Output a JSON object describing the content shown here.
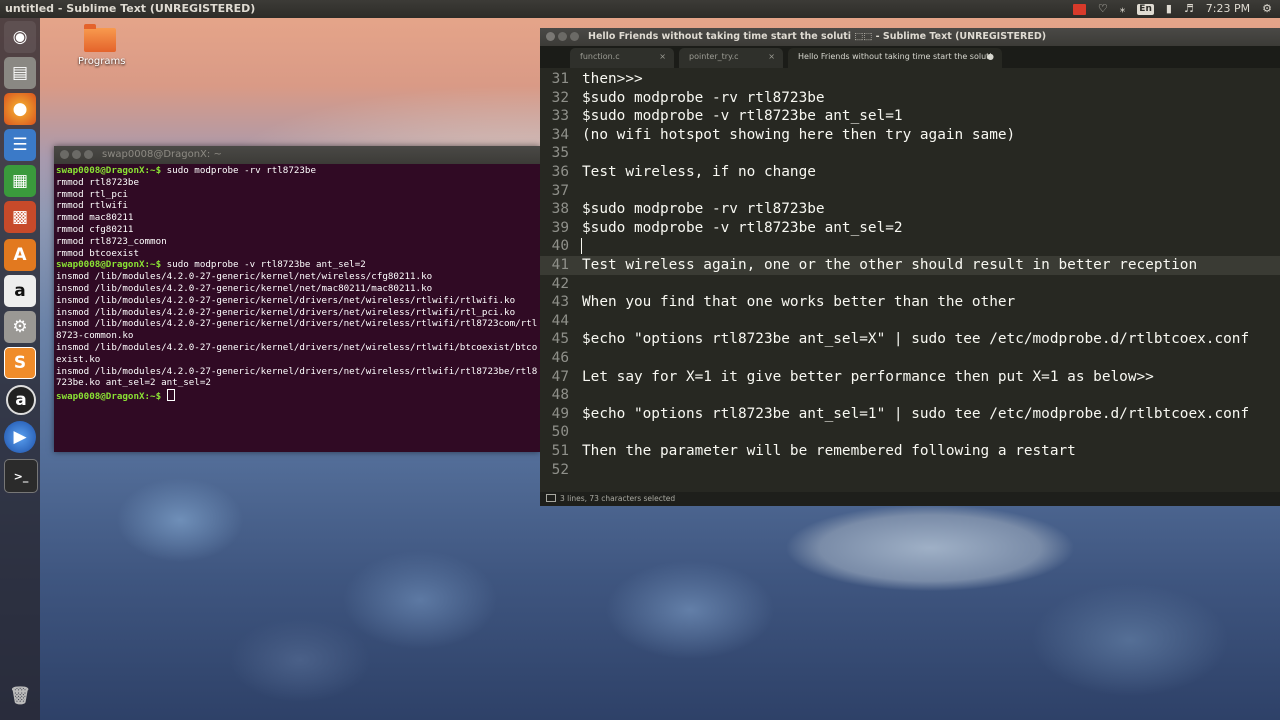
{
  "top_panel": {
    "window_title": "untitled - Sublime Text (UNREGISTERED)",
    "language": "En",
    "clock": "7:23 PM"
  },
  "desktop": {
    "icons": [
      {
        "label": "Programs",
        "icon": "folder-icon"
      }
    ]
  },
  "launcher": {
    "items": [
      "dash-icon",
      "files-icon",
      "firefox-icon",
      "writer-icon",
      "calc-icon",
      "impress-icon",
      "software-center-icon",
      "amazon-icon",
      "settings-icon",
      "sublime-text-icon",
      "amazon-alt-icon",
      "video-player-icon",
      "terminal-icon",
      "trash-icon"
    ]
  },
  "terminal": {
    "title": "swap0008@DragonX: ~",
    "lines": [
      {
        "prompt": "swap0008@DragonX:~$",
        "text": " sudo modprobe -rv rtl8723be"
      },
      {
        "prompt": "",
        "text": "rmmod rtl8723be"
      },
      {
        "prompt": "",
        "text": "rmmod rtl_pci"
      },
      {
        "prompt": "",
        "text": "rmmod rtlwifi"
      },
      {
        "prompt": "",
        "text": "rmmod mac80211"
      },
      {
        "prompt": "",
        "text": "rmmod cfg80211"
      },
      {
        "prompt": "",
        "text": "rmmod rtl8723_common"
      },
      {
        "prompt": "",
        "text": "rmmod btcoexist"
      },
      {
        "prompt": "swap0008@DragonX:~$",
        "text": " sudo modprobe -v rtl8723be ant_sel=2"
      },
      {
        "prompt": "",
        "text": "insmod /lib/modules/4.2.0-27-generic/kernel/net/wireless/cfg80211.ko"
      },
      {
        "prompt": "",
        "text": "insmod /lib/modules/4.2.0-27-generic/kernel/net/mac80211/mac80211.ko"
      },
      {
        "prompt": "",
        "text": "insmod /lib/modules/4.2.0-27-generic/kernel/drivers/net/wireless/rtlwifi/rtlwifi.ko"
      },
      {
        "prompt": "",
        "text": "insmod /lib/modules/4.2.0-27-generic/kernel/drivers/net/wireless/rtlwifi/rtl_pci.ko"
      },
      {
        "prompt": "",
        "text": "insmod /lib/modules/4.2.0-27-generic/kernel/drivers/net/wireless/rtlwifi/rtl8723com/rtl8723-common.ko"
      },
      {
        "prompt": "",
        "text": "insmod /lib/modules/4.2.0-27-generic/kernel/drivers/net/wireless/rtlwifi/btcoexist/btcoexist.ko"
      },
      {
        "prompt": "",
        "text": "insmod /lib/modules/4.2.0-27-generic/kernel/drivers/net/wireless/rtlwifi/rtl8723be/rtl8723be.ko ant_sel=2 ant_sel=2"
      },
      {
        "prompt": "swap0008@DragonX:~$",
        "text": " ",
        "cursor": true
      }
    ]
  },
  "sublime": {
    "title": "Hello Friends without taking time start the soluti ⬚⬚ - Sublime Text (UNREGISTERED)",
    "tabs": [
      {
        "label": "function.c",
        "active": false
      },
      {
        "label": "pointer_try.c",
        "active": false
      },
      {
        "label": "Hello Friends without taking time start the soluti",
        "active": true
      }
    ],
    "lines": [
      {
        "n": "31",
        "t": "then>>>"
      },
      {
        "n": "32",
        "t": "$sudo modprobe -rv rtl8723be"
      },
      {
        "n": "33",
        "t": "$sudo modprobe -v rtl8723be ant_sel=1"
      },
      {
        "n": "34",
        "t": "(no wifi hotspot showing here then try again same)"
      },
      {
        "n": "35",
        "t": ""
      },
      {
        "n": "36",
        "t": "Test wireless, if no change"
      },
      {
        "n": "37",
        "t": ""
      },
      {
        "n": "38",
        "t": "$sudo modprobe -rv rtl8723be"
      },
      {
        "n": "39",
        "t": "$sudo modprobe -v rtl8723be ant_sel=2"
      },
      {
        "n": "40",
        "t": "",
        "caret": true
      },
      {
        "n": "41",
        "t": "Test wireless again, one or the other should result in better reception",
        "selected": true
      },
      {
        "n": "42",
        "t": ""
      },
      {
        "n": "43",
        "t": "When you find that one works better than the other"
      },
      {
        "n": "44",
        "t": ""
      },
      {
        "n": "45",
        "t": "$echo \"options rtl8723be ant_sel=X\" | sudo tee /etc/modprobe.d/rtlbtcoex.conf"
      },
      {
        "n": "46",
        "t": ""
      },
      {
        "n": "47",
        "t": "Let say for X=1 it give better performance then put X=1 as below>>"
      },
      {
        "n": "48",
        "t": ""
      },
      {
        "n": "49",
        "t": "$echo \"options rtl8723be ant_sel=1\" | sudo tee /etc/modprobe.d/rtlbtcoex.conf"
      },
      {
        "n": "50",
        "t": ""
      },
      {
        "n": "51",
        "t": "Then the parameter will be remembered following a restart"
      },
      {
        "n": "52",
        "t": ""
      }
    ],
    "status": "3 lines, 73 characters selected"
  }
}
